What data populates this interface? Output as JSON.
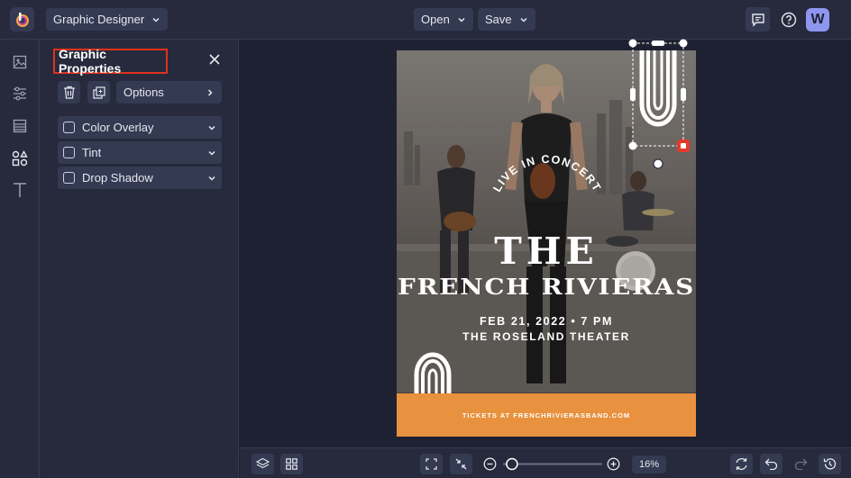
{
  "topbar": {
    "app_menu_label": "Graphic Designer",
    "open_label": "Open",
    "save_label": "Save",
    "avatar_letter": "W"
  },
  "rail": {
    "items": [
      "image-icon",
      "adjustments-icon",
      "layout-icon",
      "graphics-icon",
      "text-icon"
    ]
  },
  "panel": {
    "title": "Graphic Properties",
    "options_label": "Options",
    "properties": [
      {
        "label": "Color Overlay",
        "checked": false
      },
      {
        "label": "Tint",
        "checked": false
      },
      {
        "label": "Drop Shadow",
        "checked": false
      }
    ]
  },
  "poster": {
    "arc_text": "LIVE IN CONCERT",
    "title_line1": "THE",
    "title_line2": "FRENCH RIVIERAS",
    "date_line": "FEB 21, 2022 • 7 PM",
    "venue_line": "THE ROSELAND THEATER",
    "footer": "TICKETS AT FRENCHRIVIERASBAND.COM",
    "footer_color": "#e8913f"
  },
  "bottombar": {
    "zoom_level": "16%",
    "zoom_fraction": 0.04
  },
  "colors": {
    "accent": "#8f96f0",
    "highlight": "#e0321c",
    "selection": "#e33b2b"
  }
}
